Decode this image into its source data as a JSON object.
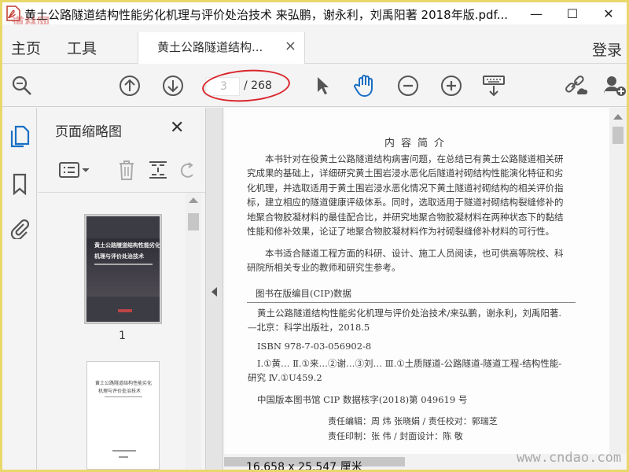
{
  "window": {
    "title": "黄土公路隧道结构性能劣化机理与评价处治技术 来弘鹏，谢永利，刘禹阳著 2018年版.pdf...",
    "watermark_top": "道林网",
    "minimize": "—",
    "maximize": "☐",
    "close": "✕"
  },
  "tabs": {
    "home": "主页",
    "tools": "工具",
    "document": "黄土公路隧道结构...",
    "document_close": "×",
    "login": "登录"
  },
  "toolbar": {
    "page_current": "3",
    "page_total": "/ 268"
  },
  "thumbnail_panel": {
    "title": "页面缩略图",
    "close": "✕",
    "page1_label": "1",
    "thumb1_title_line1": "黄土公路隧道结构性能劣化",
    "thumb1_title_line2": "机理与评价处治技术",
    "thumb2_line1": "黄土公路隧道结构性能劣化",
    "thumb2_line2": "机理与评价处治技术"
  },
  "document": {
    "heading": "内容简介",
    "paragraph1": "本书针对在役黄土公路隧道结构病害问题，在总结已有黄土公路隧道相关研究成果的基础上，详细研究黄土围岩浸水恶化后隧道衬砌结构性能演化特征和劣化机理，并选取适用于黄土围岩浸水恶化情况下黄土隧道衬砌结构的相关评价指标，建立相应的隧道健康评级体系。同时，选取适用于隧道衬砌结构裂缝修补的地聚合物胶凝材料的最佳配合比，并研究地聚合物胶凝材料在两种状态下的黏结性能和修补效果，论证了地聚合物胶凝材料作为衬砌裂缝修补材料的可行性。",
    "paragraph2": "本书适合隧道工程方面的科研、设计、施工人员阅读，也可供高等院校、科研院所相关专业的教师和研究生参考。",
    "cip_title": "图书在版编目(CIP)数据",
    "cip_line1": "黄土公路隧道结构性能劣化机理与评价处治技术/来弘鹏，谢永利，刘禹阳著. —北京：科学出版社，2018.5",
    "cip_isbn": "ISBN 978-7-03-056902-8",
    "cip_class": "Ⅰ.①黄… Ⅱ.①来…②谢…③刘… Ⅲ.①土质隧道-公路隧道-隧道工程-结构性能-研究 Ⅳ.①U459.2",
    "cip_number": "中国版本图书馆 CIP 数据核字(2018)第 049619 号",
    "credits_line1": "责任编辑：周 炜 张晓娟 / 责任校对：郭瑞芝",
    "credits_line2": "责任印制：张 伟 / 封面设计：陈 敬"
  },
  "status": {
    "page_size": "16.658 x 25.547 厘米"
  },
  "watermark_bottom": "www.cndao.com"
}
